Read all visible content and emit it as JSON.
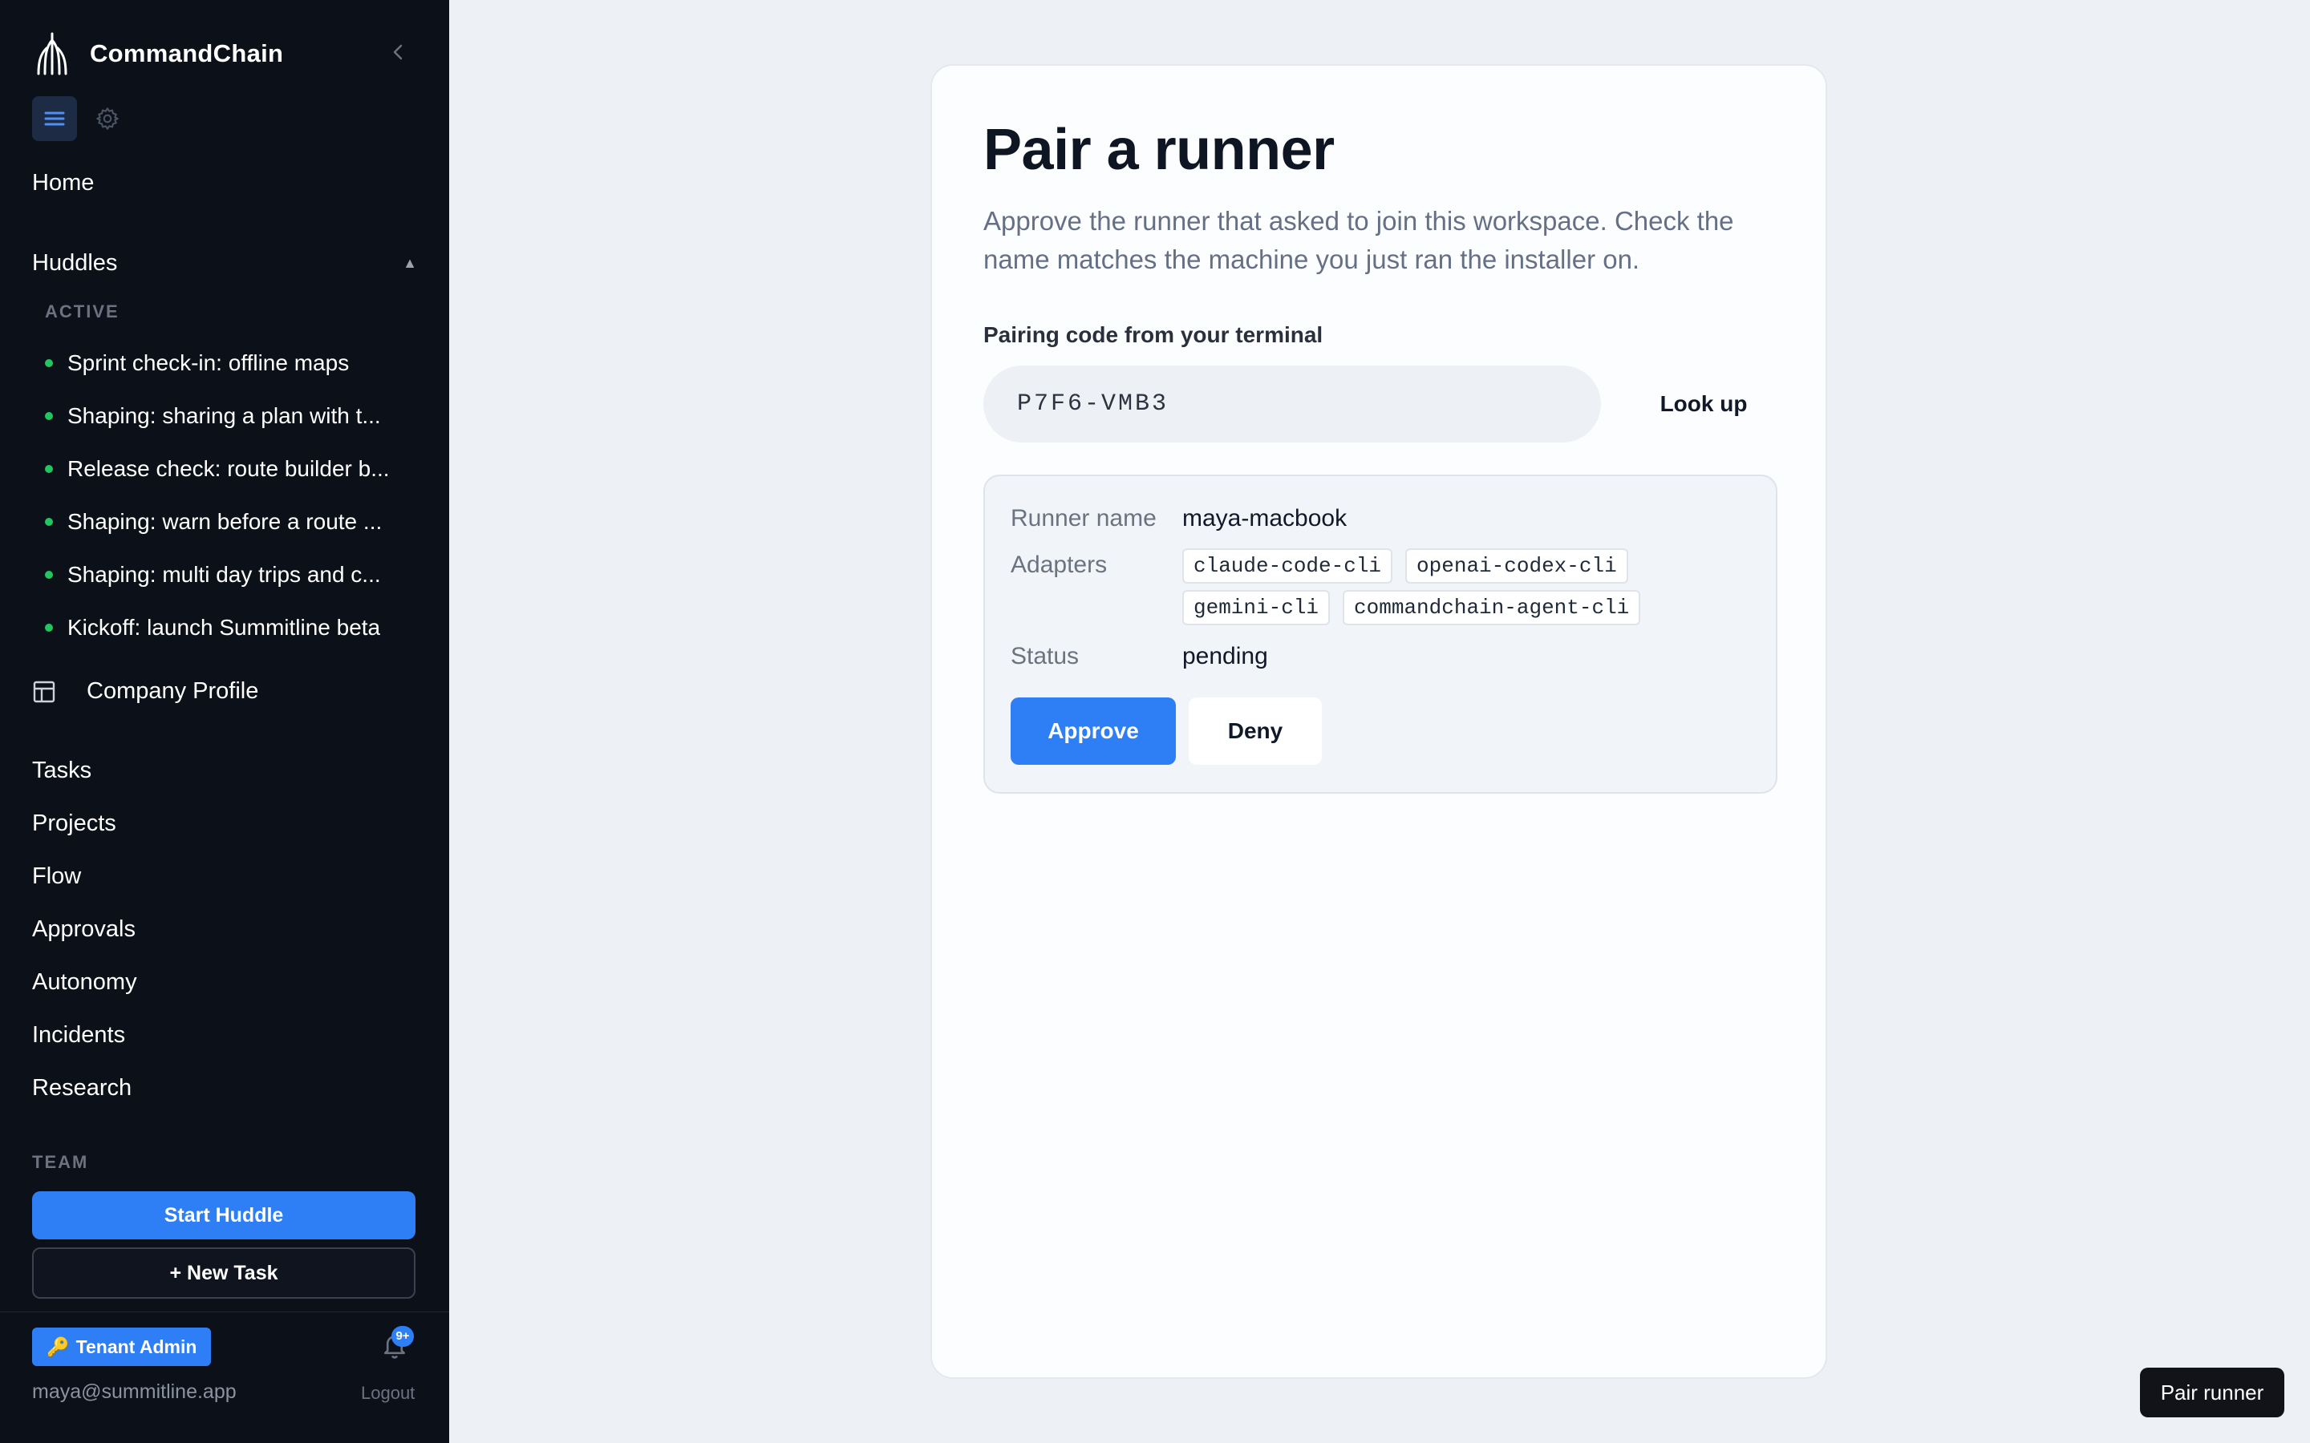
{
  "app": {
    "name": "CommandChain"
  },
  "sidebar": {
    "home_label": "Home",
    "huddles": {
      "label": "Huddles",
      "caret": "▲",
      "active_label": "ACTIVE",
      "items": [
        {
          "label": "Sprint check-in: offline maps"
        },
        {
          "label": "Shaping: sharing a plan with t..."
        },
        {
          "label": "Release check: route builder b..."
        },
        {
          "label": "Shaping: warn before a route ..."
        },
        {
          "label": "Shaping: multi day trips and c..."
        },
        {
          "label": "Kickoff: launch Summitline beta"
        }
      ]
    },
    "company_profile_label": "Company Profile",
    "nav_items": [
      {
        "label": "Tasks"
      },
      {
        "label": "Projects"
      },
      {
        "label": "Flow"
      },
      {
        "label": "Approvals"
      },
      {
        "label": "Autonomy"
      },
      {
        "label": "Incidents"
      },
      {
        "label": "Research"
      }
    ],
    "team_label": "TEAM",
    "start_huddle_label": "Start Huddle",
    "new_task_label": "+ New Task",
    "tenant_badge": {
      "icon": "🔑",
      "label": "Tenant Admin"
    },
    "notifications_badge": "9+",
    "user_email": "maya@summitline.app",
    "logout_label": "Logout"
  },
  "main": {
    "title": "Pair a runner",
    "description": "Approve the runner that asked to join this workspace. Check the name matches the machine you just ran the installer on.",
    "code_label": "Pairing code from your terminal",
    "code_value": "P7F6-VMB3",
    "lookup_label": "Look up",
    "runner": {
      "name_label": "Runner name",
      "name_value": "maya-macbook",
      "adapters_label": "Adapters",
      "adapters": [
        "claude-code-cli",
        "openai-codex-cli",
        "gemini-cli",
        "commandchain-agent-cli"
      ],
      "status_label": "Status",
      "status_value": "pending"
    },
    "approve_label": "Approve",
    "deny_label": "Deny"
  },
  "floating_chip": {
    "label": "Pair runner"
  },
  "colors": {
    "sidebar_bg": "#0b1019",
    "accent": "#2e7ff5",
    "active_dot": "#22c55e",
    "page_bg": "#edf1f6"
  },
  "icons": [
    "commandchain-logo",
    "chevron-left-icon",
    "menu-icon",
    "gear-icon",
    "layout-icon",
    "bell-icon",
    "key-icon"
  ]
}
